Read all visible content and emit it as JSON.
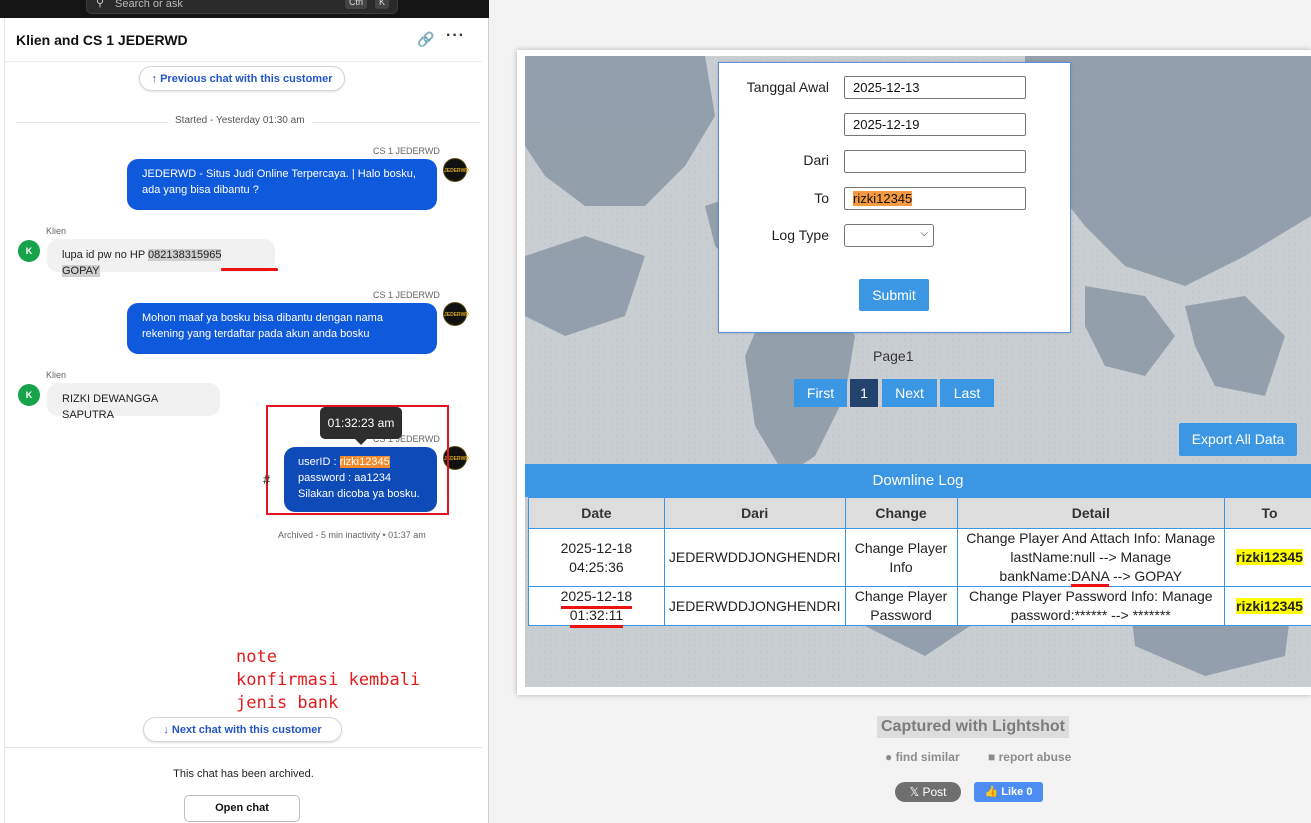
{
  "search": {
    "placeholder": "Search or ask",
    "kbd1": "Ctrl",
    "kbd2": "K"
  },
  "chat": {
    "title": "Klien and CS 1 JEDERWD",
    "previous_chat": "Previous chat with this customer",
    "started": "Started - Yesterday 01:30 am",
    "messages": [
      {
        "sender": "CS 1 JEDERWD",
        "line1": "JEDERWD - Situs Judi Online Terpercaya. | Halo bosku,",
        "line2": "ada yang bisa dibantu ?"
      },
      {
        "sender": "Klien",
        "avatar": "K",
        "text_pre": "lupa id pw no HP ",
        "text_hl": "082138315965 GOPAY"
      },
      {
        "sender": "CS 1 JEDERWD",
        "line1": "Mohon maaf ya bosku bisa dibantu dengan nama",
        "line2": "rekening yang terdaftar pada akun anda bosku"
      },
      {
        "sender": "Klien",
        "avatar": "K",
        "text": "RIZKI DEWANGGA SAPUTRA"
      },
      {
        "sender": "CS 1 JEDERWD",
        "userid_label": "userID : ",
        "userid_value": "rizki12345",
        "password": "password : aa1234",
        "line3": "Silakan dicoba ya bosku."
      }
    ],
    "cs_avatar_text": "JEDERWD",
    "tooltip": "01:32:23 am",
    "hash": "#",
    "archived_line": "Archived - 5 min inactivity • 01:37 am",
    "next_chat": "Next chat with this customer",
    "archived_msg": "This chat has been archived.",
    "open_chat": "Open chat"
  },
  "note": {
    "line1": "note",
    "line2": "konfirmasi kembali jenis bank"
  },
  "form": {
    "tanggal_awal_label": "Tanggal Awal",
    "tanggal_awal": "2025-12-13",
    "tanggal_akhir": "2025-12-19",
    "dari_label": "Dari",
    "dari": "",
    "to_label": "To",
    "to": "rizki12345",
    "log_type_label": "Log Type",
    "submit": "Submit"
  },
  "pagination": {
    "label": "Page1",
    "first": "First",
    "current": "1",
    "next": "Next",
    "last": "Last"
  },
  "export": "Export All Data",
  "log": {
    "title": "Downline Log",
    "headers": [
      "Date",
      "Dari",
      "Change",
      "Detail",
      "To"
    ],
    "rows": [
      {
        "date": "2025-12-18 04:25:36",
        "dari": "JEDERWDDJONGHENDRI",
        "change1": "Change Player",
        "change2": "Info",
        "detail1": "Change Player And Attach Info: Manage",
        "detail2": "lastName:null --> Manage",
        "detail3_pre": "bankName:",
        "detail3_hl": "DANA",
        "detail3_post": " --> GOPAY",
        "to": "rizki12345"
      },
      {
        "date": "2025-12-18 01:32:11",
        "dari": "JEDERWDDJONGHENDRI",
        "change1": "Change Player",
        "change2": "Password",
        "detail1": "Change Player Password Info: Manage",
        "detail2": "password:****** --> *******",
        "to": "rizki12345"
      }
    ]
  },
  "lightshot": {
    "captured": "Captured with Lightshot",
    "find_similar": "find similar",
    "report_abuse": "report abuse",
    "post": "Post",
    "like": "Like 0"
  },
  "colors": {
    "accent": "#3b97e3",
    "chat_blue": "#0f59dc",
    "annotation_red": "#e21b1b",
    "highlight_yellow": "#ffff00"
  }
}
